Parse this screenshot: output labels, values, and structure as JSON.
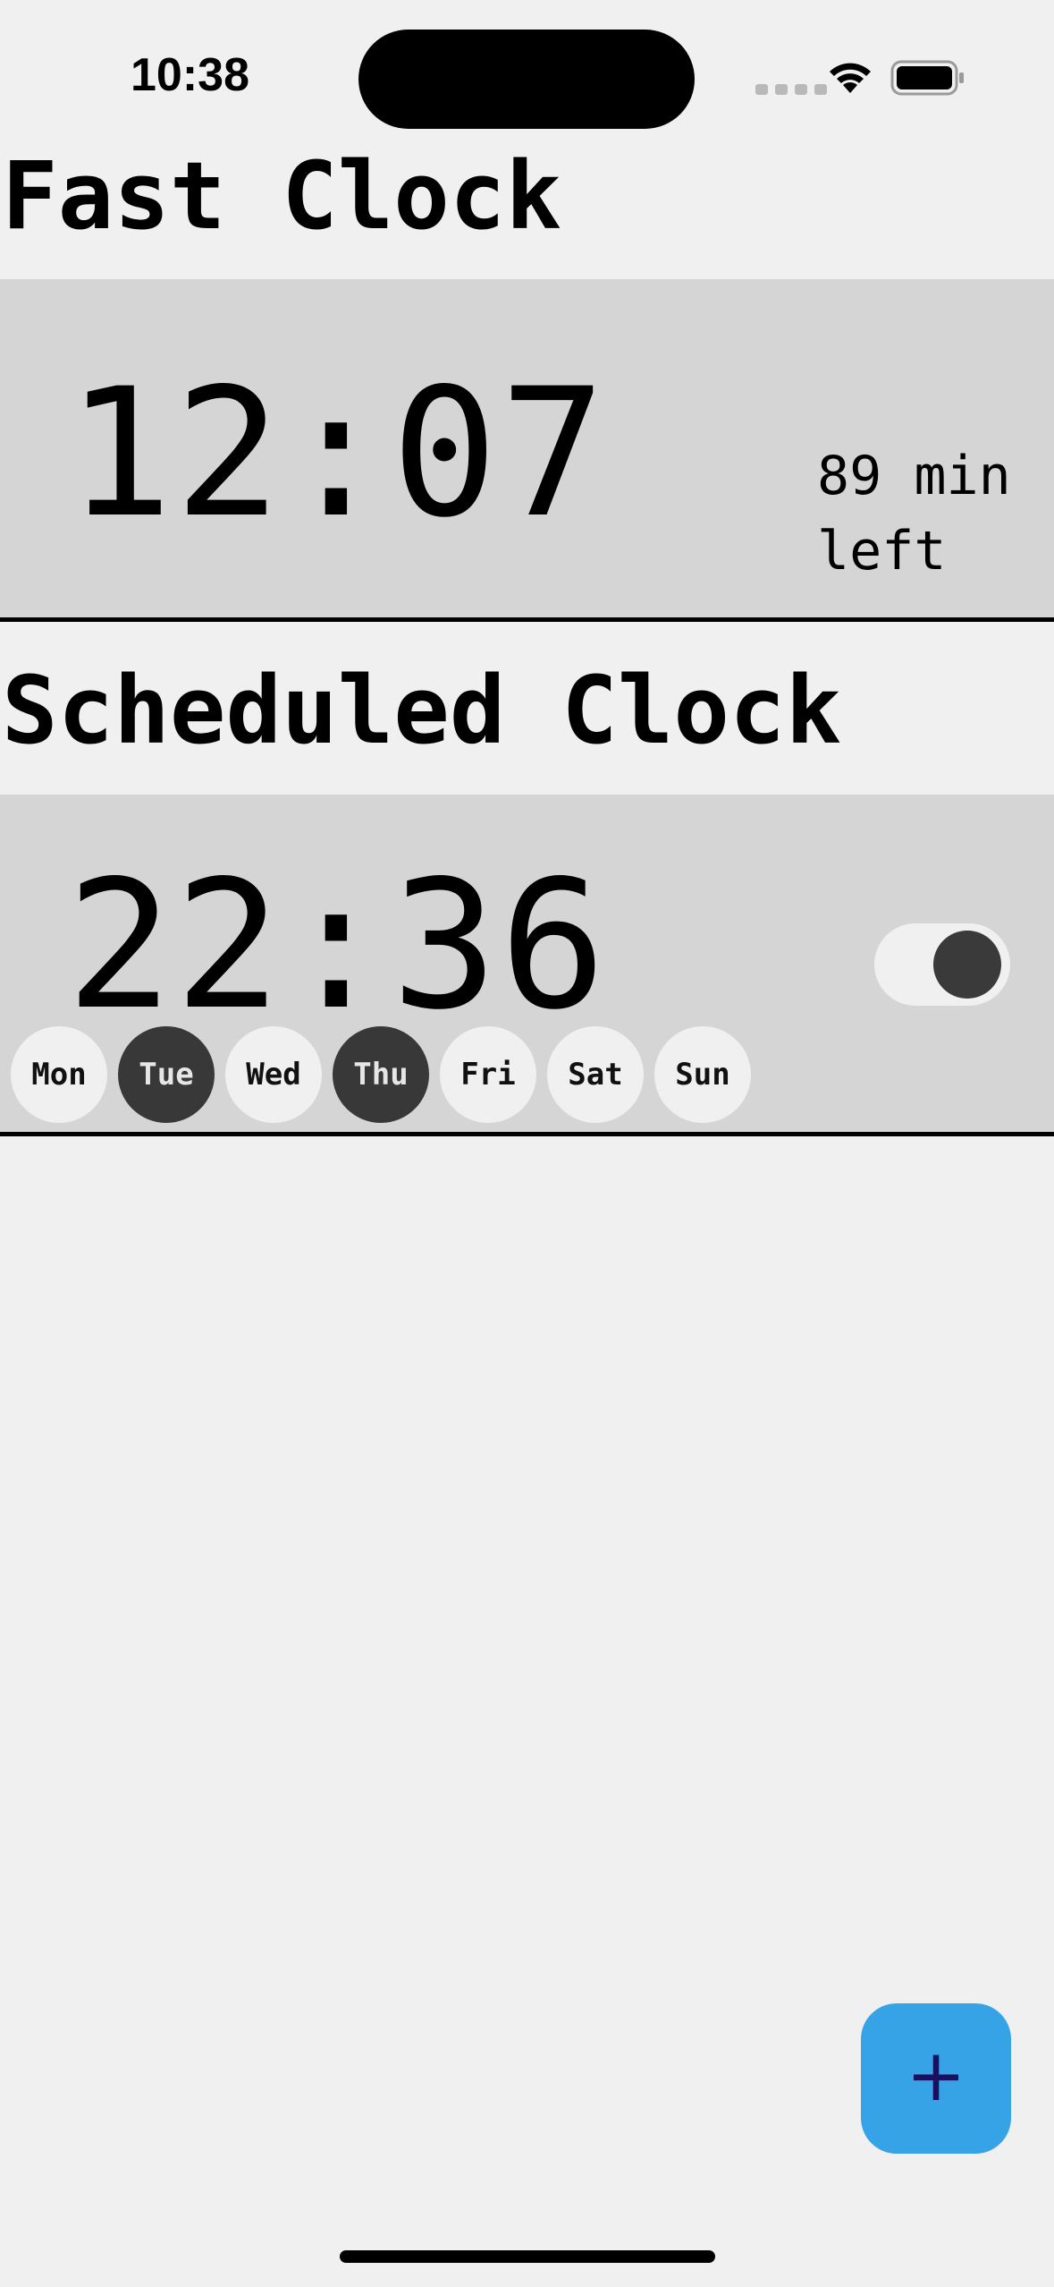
{
  "status_bar": {
    "time": "10:38"
  },
  "fast_clock": {
    "title": "Fast Clock",
    "time": "12:07",
    "remaining": "89 min left"
  },
  "scheduled_clock": {
    "title": "Scheduled Clock",
    "time": "22:36",
    "enabled": true,
    "days": [
      {
        "label": "Mon",
        "selected": false
      },
      {
        "label": "Tue",
        "selected": true
      },
      {
        "label": "Wed",
        "selected": false
      },
      {
        "label": "Thu",
        "selected": true
      },
      {
        "label": "Fri",
        "selected": false
      },
      {
        "label": "Sat",
        "selected": false
      },
      {
        "label": "Sun",
        "selected": false
      }
    ]
  },
  "fab": {
    "icon": "plus-icon",
    "symbol": "+",
    "color": "#35a3e6"
  }
}
